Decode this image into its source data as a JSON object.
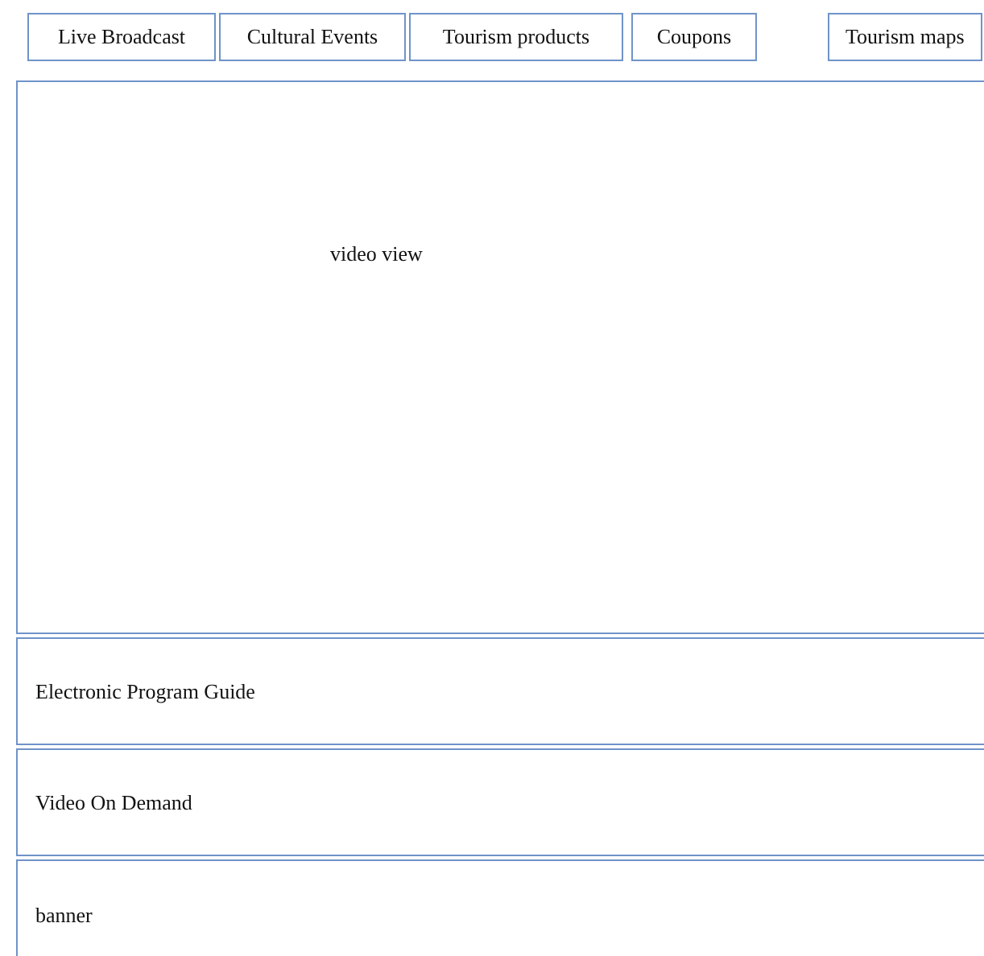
{
  "tabs": [
    {
      "label": "Live Broadcast"
    },
    {
      "label": "Cultural Events"
    },
    {
      "label": "Tourism products"
    },
    {
      "label": "Coupons"
    },
    {
      "label": "Tourism maps"
    }
  ],
  "video": {
    "label": "video view"
  },
  "sections": [
    {
      "label": "Electronic Program Guide"
    },
    {
      "label": "Video On Demand"
    },
    {
      "label": "banner"
    }
  ]
}
